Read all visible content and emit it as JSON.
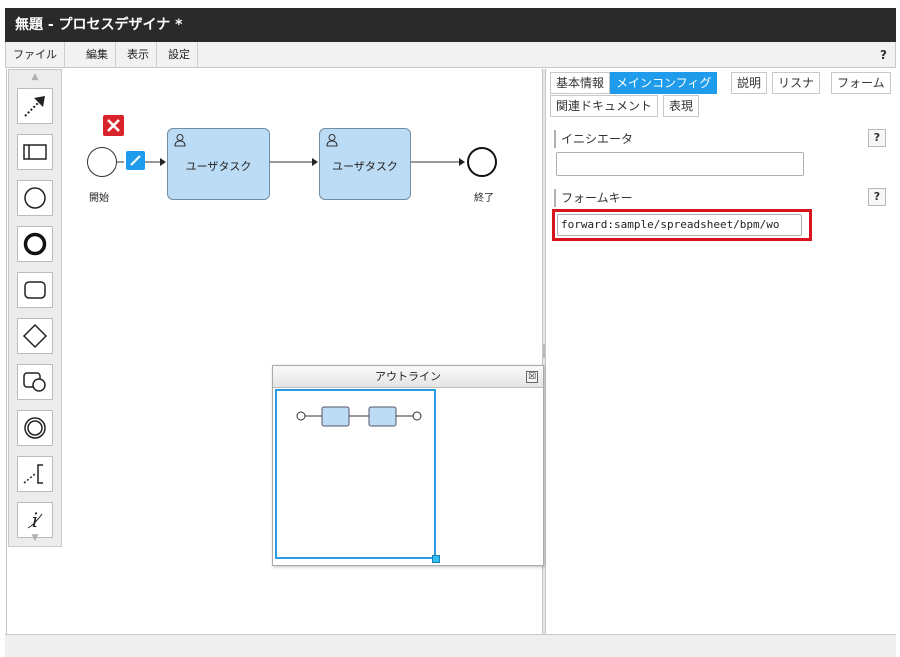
{
  "window": {
    "title": "無題 - プロセスデザイナ *"
  },
  "menubar": {
    "items": [
      "ファイル",
      "編集",
      "表示",
      "設定"
    ],
    "help": "?"
  },
  "palette": {
    "up_arrow": "▲",
    "down_arrow": "▼",
    "tools": [
      "connector-tool-icon",
      "pool-icon",
      "start-event-icon",
      "end-event-icon",
      "task-icon",
      "gateway-icon",
      "subprocess-icon",
      "intermediate-event-icon",
      "annotation-icon",
      "info-icon"
    ]
  },
  "diagram": {
    "start_label": "開始",
    "end_label": "終了",
    "task1_label": "ユーザタスク",
    "task2_label": "ユーザタスク",
    "task_color": "#bcdcf6",
    "delete_color": "#d9232a",
    "connector_color": "#1e9bea"
  },
  "outline": {
    "title": "アウトライン",
    "close": "☒"
  },
  "properties": {
    "tabs_row1": [
      "基本情報",
      "メインコンフィグ",
      "説明",
      "リスナ",
      "フォーム"
    ],
    "tabs_row2": [
      "関連ドキュメント",
      "表現"
    ],
    "active_tab": "メインコンフィグ",
    "initiator_label": "イニシエータ",
    "initiator_value": "",
    "form_key_label": "フォームキー",
    "form_key_value": "forward:sample/spreadsheet/bpm/wo",
    "help": "?",
    "accent_color": "#1e9bea",
    "highlight_color": "#d8151d"
  }
}
